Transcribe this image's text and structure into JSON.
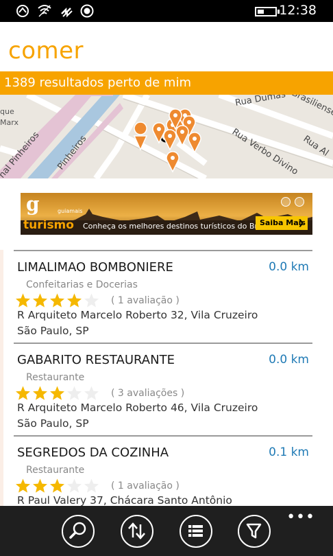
{
  "status_bar": {
    "time": "12:38",
    "icons": [
      "nfc-icon",
      "wifi-icon",
      "sync-icon",
      "location-icon",
      "battery-icon"
    ]
  },
  "app": {
    "title": "comer",
    "results_text": "1389 resultados perto de mim"
  },
  "map": {
    "labels": [
      "que",
      "Marx",
      "Pinheiros",
      "nal Pinheiros",
      "Rua Verbo Divino",
      "Rua Dumas",
      "Brasiliense",
      "Rua Al"
    ]
  },
  "ad": {
    "logo_g": "g",
    "logo_small": "guiamais",
    "logo_main": "turismo",
    "text": "Conheça os melhores destinos turísticos do Brasil.",
    "button": "Saiba Mais"
  },
  "results": [
    {
      "name": "LIMALIMAO BOMBONIERE",
      "distance": "0.0 km",
      "category": "Confeitarias e Docerias",
      "rating": 4,
      "reviews": "( 1 avaliação )",
      "address1": "R Arquiteto Marcelo Roberto 32, Vila Cruzeiro",
      "address2": "São Paulo, SP"
    },
    {
      "name": "GABARITO RESTAURANTE",
      "distance": "0.0 km",
      "category": "Restaurante",
      "rating": 3,
      "reviews": "( 3 avaliações )",
      "address1": "R Arquiteto Marcelo Roberto 46, Vila Cruzeiro",
      "address2": "São Paulo, SP"
    },
    {
      "name": "SEGREDOS DA COZINHA",
      "distance": "0.1 km",
      "category": "Restaurante",
      "rating": 3,
      "reviews": "( 1 avaliação )",
      "address1": "R Paul Valery 37, Chácara Santo Antônio",
      "address2": ""
    }
  ],
  "appbar": {
    "buttons": [
      "search-icon",
      "sort-icon",
      "list-icon",
      "filter-icon"
    ],
    "more": "•••"
  },
  "colors": {
    "accent": "#f7a300",
    "distance": "#1f7ab5",
    "star_on": "#f5b800",
    "star_off": "#eeeeee"
  }
}
